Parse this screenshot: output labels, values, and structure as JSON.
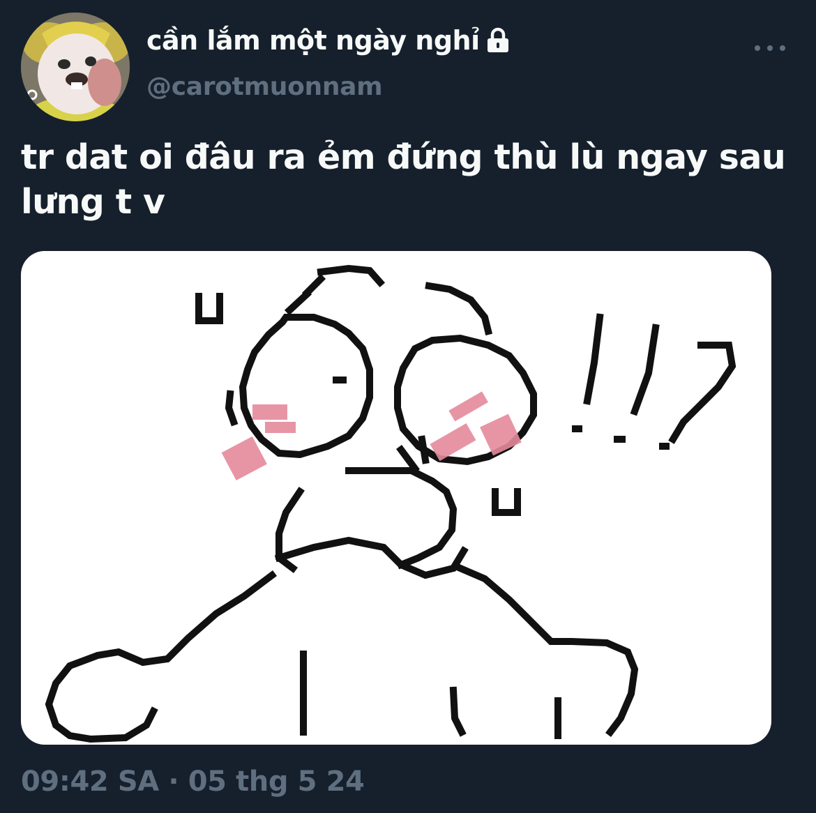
{
  "author": {
    "display_name": "cần lắm một ngày nghỉ",
    "handle": "@carotmuonnam",
    "protected": true
  },
  "tweet": {
    "text": "tr dat oi đâu ra ẻm đứng thù lù ngay sau lưng t v"
  },
  "meta": {
    "time": "09:42 SA",
    "separator": " · ",
    "date": "05 thg 5 24"
  },
  "icons": {
    "lock": "lock-icon",
    "more": "more-horizontal-icon"
  },
  "colors": {
    "background": "#16202c",
    "primary_text": "#f7f9f9",
    "secondary_text": "#5f6f7f",
    "blush": "#e58a9c"
  }
}
